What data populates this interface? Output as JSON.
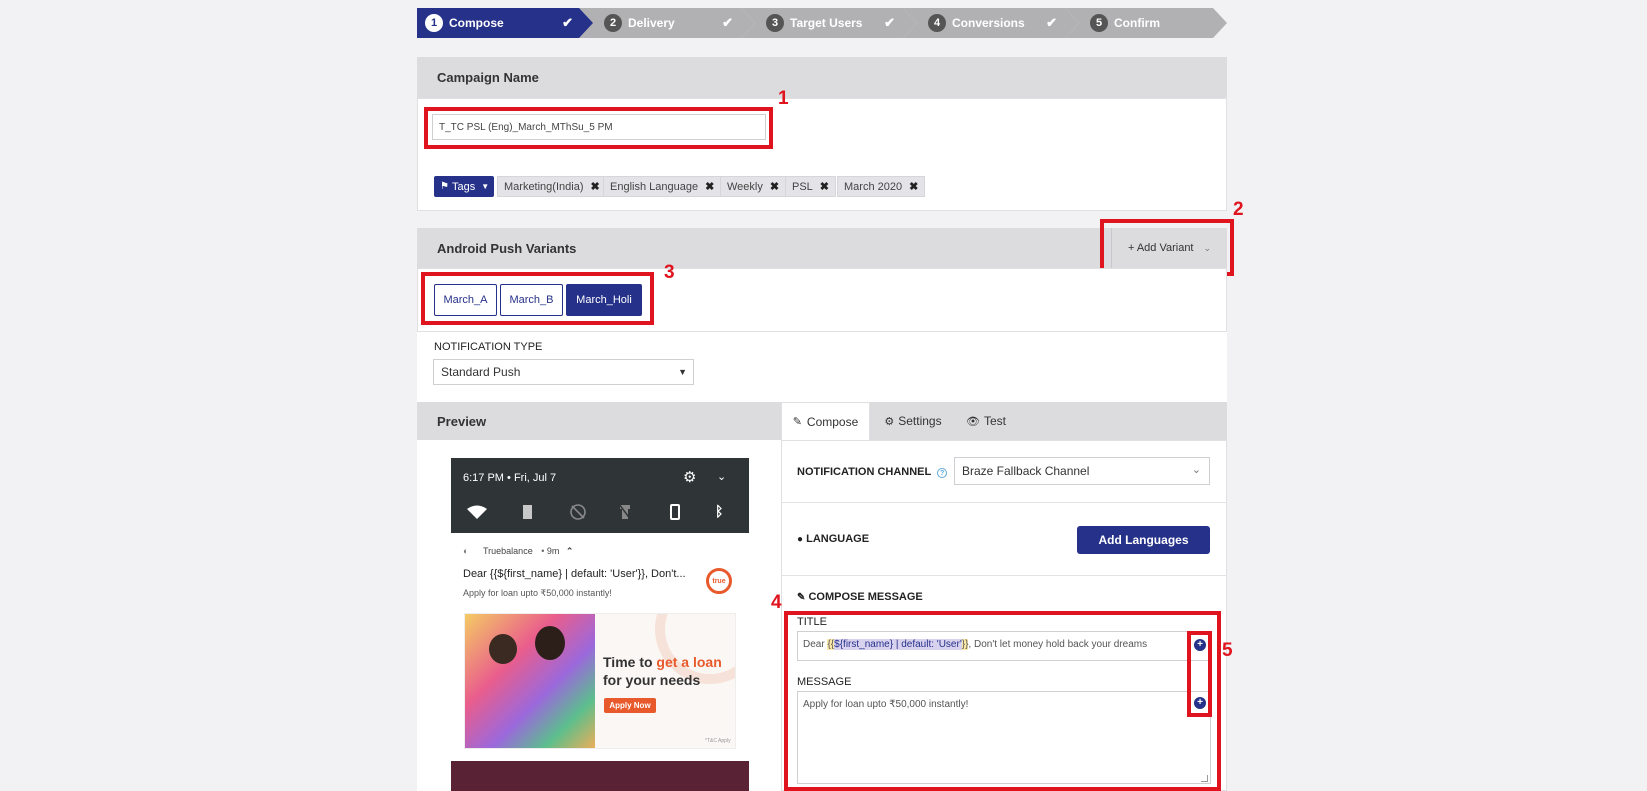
{
  "stepper": {
    "steps": [
      {
        "num": "1",
        "label": "Compose"
      },
      {
        "num": "2",
        "label": "Delivery"
      },
      {
        "num": "3",
        "label": "Target Users"
      },
      {
        "num": "4",
        "label": "Conversions"
      },
      {
        "num": "5",
        "label": "Confirm"
      }
    ],
    "check": "✔"
  },
  "campaign": {
    "header": "Campaign Name",
    "name_value": "T_TC PSL (Eng)_March_MThSu_5 PM",
    "tags_label": "Tags",
    "tags": [
      "Marketing(India)",
      "English Language",
      "Weekly",
      "PSL",
      "March 2020"
    ],
    "tag_remove": "✖"
  },
  "variants": {
    "header": "Android Push Variants",
    "add_label": "+ Add Variant",
    "items": [
      "March_A",
      "March_B",
      "March_Holi"
    ],
    "active": "March_Holi"
  },
  "notification_type": {
    "label": "NOTIFICATION TYPE",
    "value": "Standard Push"
  },
  "preview": {
    "header": "Preview",
    "status_time": "6:17 PM",
    "status_date": "Fri, Jul 7",
    "app_name": "Truebalance",
    "app_time": "9m",
    "title": "Dear {{${first_name} | default: 'User'}}, Don't...",
    "body": "Apply for loan upto ₹50,000 instantly!",
    "logo_text": "true",
    "banner_line1a": "Time to ",
    "banner_line1b": "get a loan",
    "banner_line2": "for your needs",
    "banner_button": "Apply Now",
    "banner_tc": "*T&C Apply"
  },
  "compose_tabs": {
    "compose": "Compose",
    "settings": "Settings",
    "test": "Test"
  },
  "compose": {
    "channel_label": "NOTIFICATION CHANNEL",
    "channel_value": "Braze Fallback Channel",
    "language_label": "LANGUAGE",
    "add_languages": "Add Languages",
    "compose_message_label": "COMPOSE MESSAGE",
    "title_label": "TITLE",
    "title_prefix": "Dear ",
    "title_liquid_open": "{{",
    "title_liquid_var": "${first_name} | default: 'User'",
    "title_liquid_close": "}}",
    "title_suffix": ", Don't let money hold back your dreams",
    "message_label": "MESSAGE",
    "message_value": "Apply for loan upto ₹50,000 instantly!"
  },
  "annotations": [
    "1",
    "2",
    "3",
    "4",
    "5"
  ],
  "colors": {
    "brand": "#26318a",
    "annotation_red": "#e0141e",
    "panel_header": "#dcdcdf",
    "step_inactive": "#b1b1b3"
  }
}
